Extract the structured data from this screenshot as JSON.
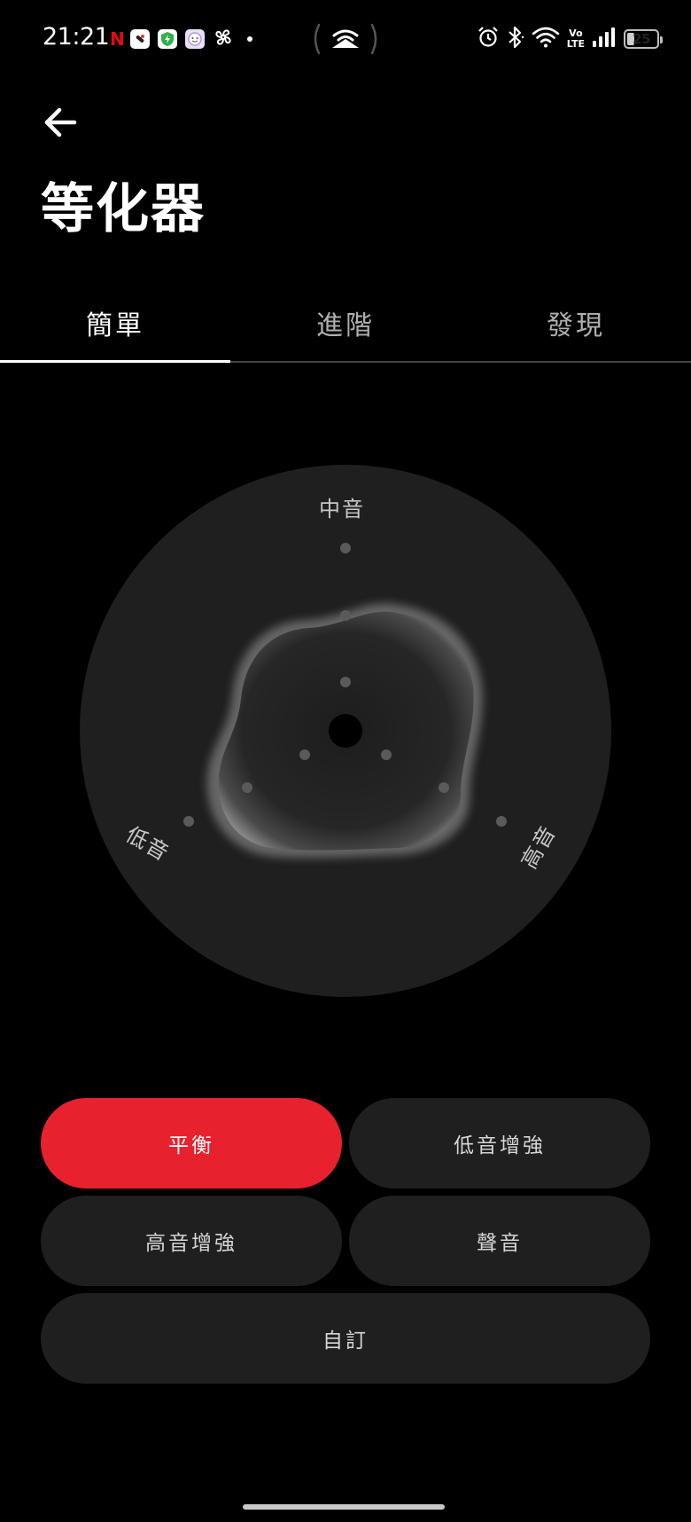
{
  "status_bar": {
    "time": "21:21",
    "netflix_glyph": "N",
    "battery_level": "25",
    "icons": [
      "netflix-icon",
      "app-icon",
      "shield-icon",
      "face-app-icon",
      "fan-icon",
      "notification-dot-icon",
      "cast-icon",
      "alarm-icon",
      "bluetooth-icon",
      "wifi-icon",
      "volte-icon",
      "signal-icon",
      "battery-icon"
    ],
    "volte_top": "Vo",
    "volte_bottom": "LTE"
  },
  "header": {
    "title": "等化器",
    "back_icon": "arrow-left-icon"
  },
  "tabs": [
    {
      "label": "簡單",
      "active": true
    },
    {
      "label": "進階",
      "active": false
    },
    {
      "label": "發現",
      "active": false
    }
  ],
  "eq": {
    "labels": {
      "mid": "中音",
      "bass": "低音",
      "treble": "高音"
    }
  },
  "presets": [
    {
      "label": "平衡",
      "active": true
    },
    {
      "label": "低音增強",
      "active": false
    },
    {
      "label": "高音增強",
      "active": false
    },
    {
      "label": "聲音",
      "active": false
    },
    {
      "label": "自訂",
      "active": false
    }
  ],
  "colors": {
    "background": "#000000",
    "dial": "#1f1f1f",
    "accent": "#e8212e",
    "button": "#1f1f1f"
  }
}
